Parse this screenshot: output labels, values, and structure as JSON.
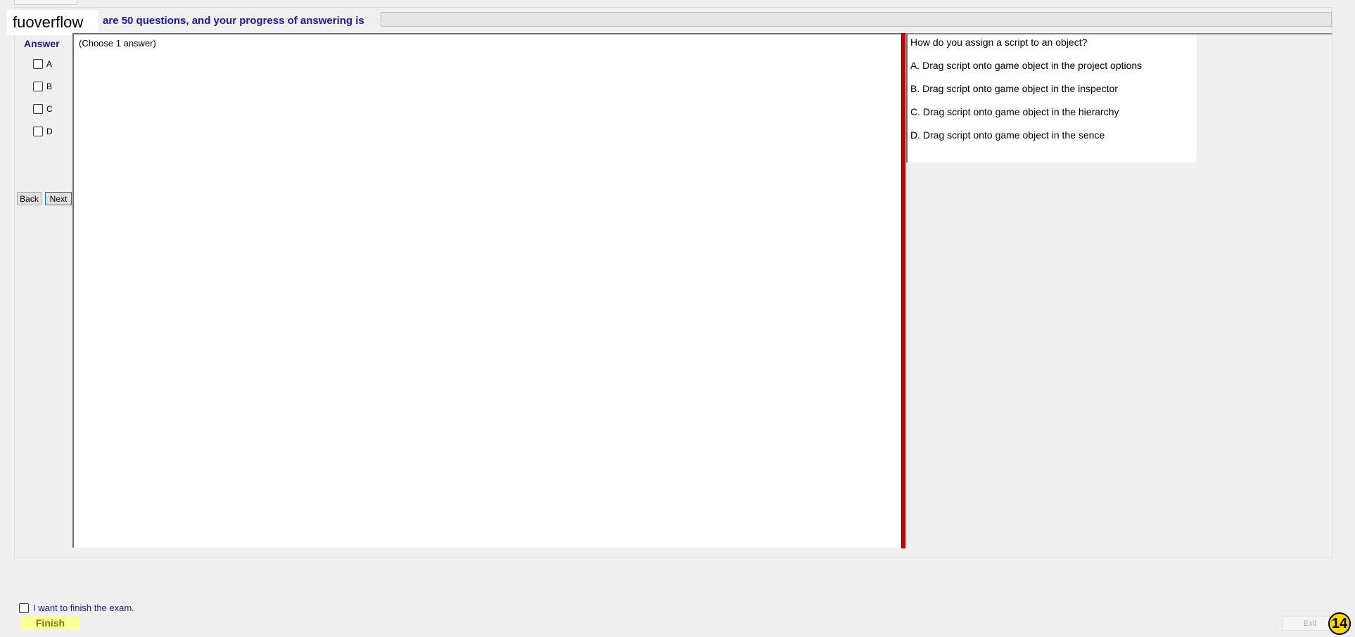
{
  "header": {
    "brand": "fuoverflow",
    "info_text": "are 50 questions, and your progress of answering is",
    "progress_value": 0
  },
  "answer_panel": {
    "title": "Answer",
    "options": [
      "A",
      "B",
      "C",
      "D"
    ],
    "back_label": "Back",
    "next_label": "Next"
  },
  "content": {
    "choose_text": "(Choose 1 answer)"
  },
  "question": {
    "text": "How do you assign a script to an object?",
    "choices": [
      "A.  Drag script onto game object in the project options",
      "B.  Drag script onto game object in the inspector",
      "C.  Drag script onto game object in the hierarchy",
      "D.  Drag script onto game object in the sence"
    ]
  },
  "footer": {
    "finish_check_label": "I want to finish the exam.",
    "finish_label": "Finish",
    "exit_label": "Exit",
    "badge": "14"
  },
  "colors": {
    "label_blue": "#1a1a9c",
    "divider_red": "#cc0000",
    "finish_yellow": "#ffff99",
    "badge_yellow": "#ffd700"
  }
}
